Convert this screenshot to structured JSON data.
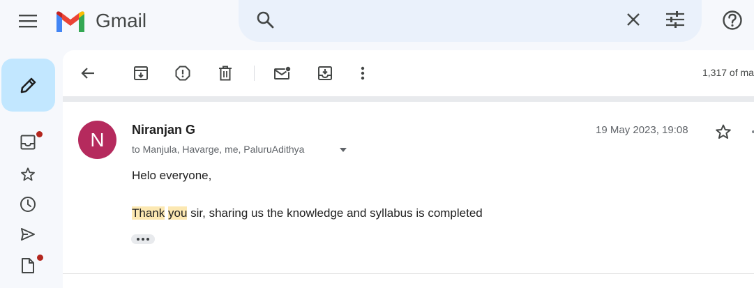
{
  "app": {
    "name": "Gmail"
  },
  "header": {
    "menu_icon": "hamburger-menu-icon",
    "search": {
      "placeholder": "",
      "value": ""
    },
    "icons": [
      "search-icon",
      "close-icon",
      "tune-icon",
      "help-icon"
    ]
  },
  "rail": {
    "compose_icon": "pencil-icon",
    "items": [
      {
        "icon": "inbox-icon",
        "badge": true
      },
      {
        "icon": "star-icon",
        "badge": false
      },
      {
        "icon": "clock-icon",
        "badge": false
      },
      {
        "icon": "send-icon",
        "badge": false
      },
      {
        "icon": "draft-icon",
        "badge": true
      }
    ]
  },
  "toolbar": {
    "icons": [
      "back-arrow-icon",
      "archive-icon",
      "report-spam-icon",
      "delete-icon",
      "mark-unread-icon",
      "move-to-icon",
      "more-vert-icon"
    ],
    "count_text": "1,317 of ma"
  },
  "message": {
    "avatar_letter": "N",
    "avatar_color": "#b52a5d",
    "sender": "Niranjan G",
    "recipients": "to Manjula, Havarge, me, PaluruAdithya",
    "date": "19 May 2023, 19:08",
    "greeting": "Helo everyone,",
    "body": {
      "hl1": "Thank",
      "space": " ",
      "hl2": "you",
      "rest": " sir, sharing us the knowledge and syllabus is completed"
    },
    "highlight_color": "#fce8b2"
  }
}
